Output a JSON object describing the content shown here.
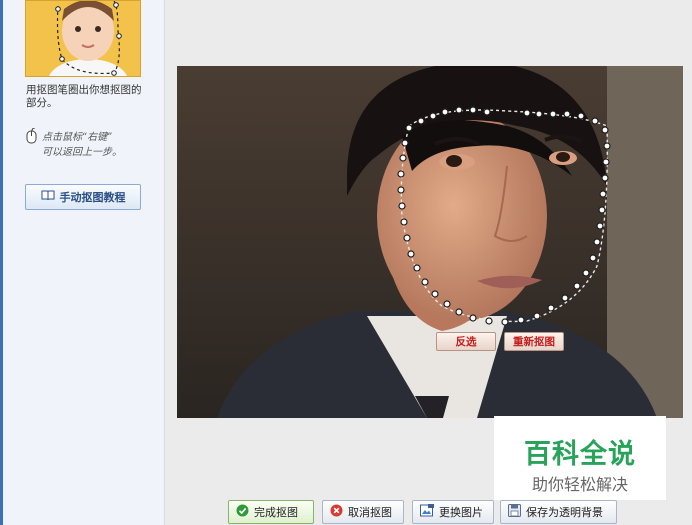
{
  "sidebar": {
    "instruction": "用抠图笔圈出你想抠图的部分。",
    "hint_line1": "点击鼠标“右键”",
    "hint_line2": "可以返回上一步。",
    "tutorial_label": "手动抠图教程"
  },
  "canvas": {
    "invert_label": "反选",
    "reselect_label": "重新抠图"
  },
  "toolbar": {
    "finish_label": "完成抠图",
    "cancel_label": "取消抠图",
    "replace_label": "更换图片",
    "save_label": "保存为透明背景"
  },
  "watermark": {
    "title": "百科全说",
    "subtitle": "助你轻松解决"
  },
  "colors": {
    "accent_blue": "#3f6fb8",
    "button_text_red": "#c21d1d",
    "watermark_green": "#27a35a"
  },
  "icons": {
    "tutorial": "book-icon",
    "finish": "check-circle-icon",
    "cancel": "cancel-circle-icon",
    "replace": "image-icon",
    "save": "save-disk-icon",
    "hint": "mouse-icon"
  }
}
